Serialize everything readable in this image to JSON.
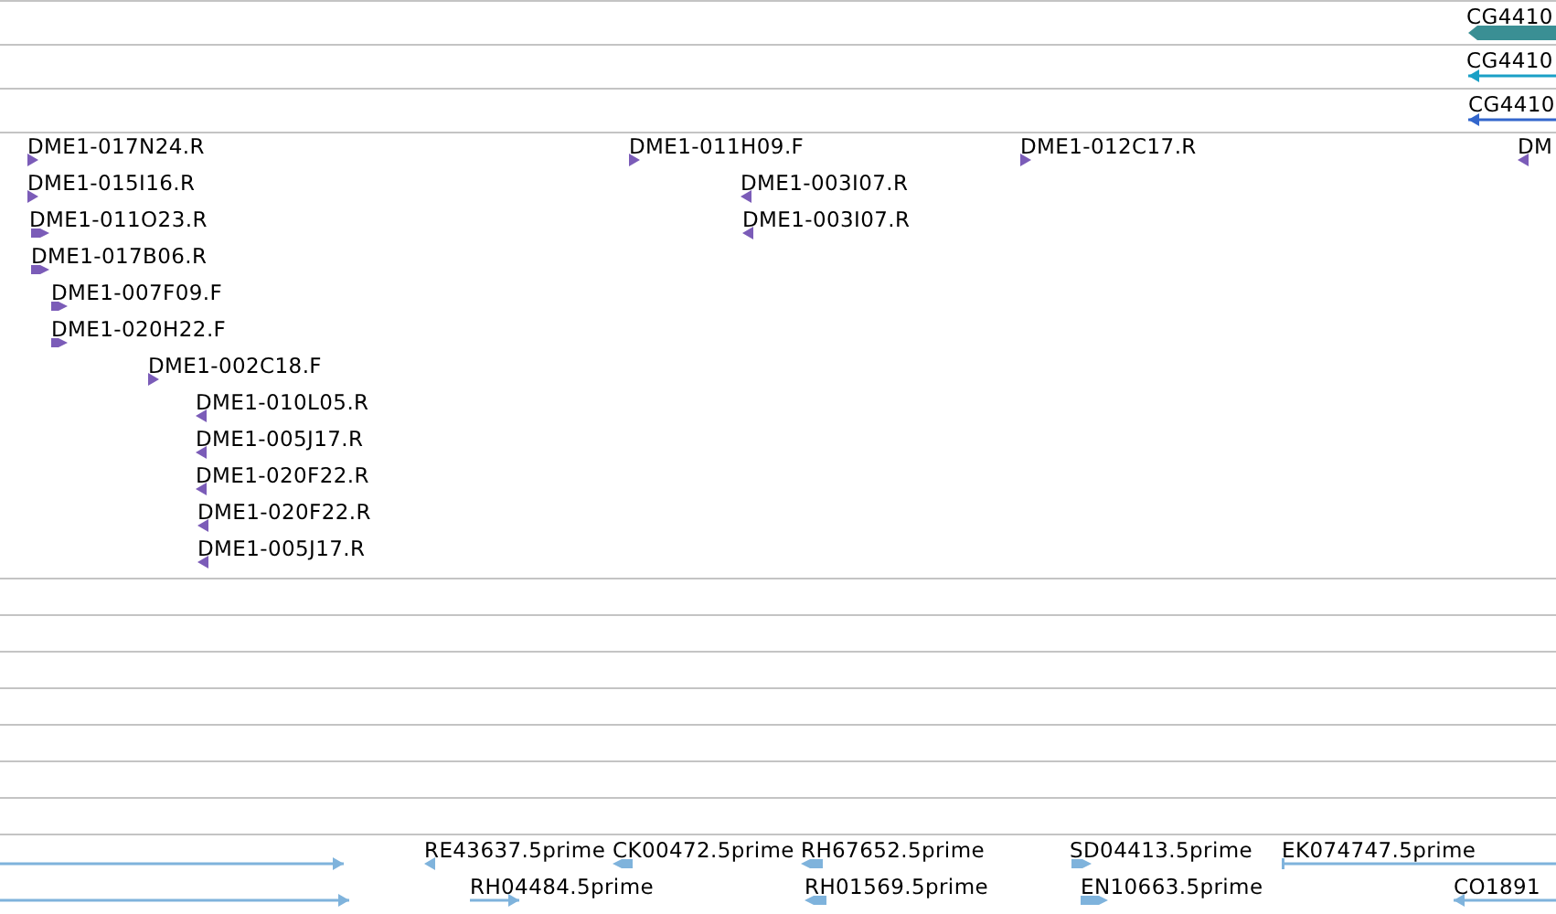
{
  "tracks": [
    {
      "color": "#3a8f94",
      "features": [
        {
          "label": "CG4410",
          "kind": "thick",
          "reverse": true
        }
      ]
    },
    {
      "color": "#1aa0c6",
      "features": [
        {
          "label": "CG4410",
          "kind": "line",
          "reverse": true
        }
      ]
    },
    {
      "color": "#3366cc",
      "features": [
        {
          "label": "CG4410",
          "kind": "line",
          "reverse": true
        }
      ]
    },
    {
      "color": "#7b5cb8",
      "features": [
        {
          "label": "DME1-017N24.R",
          "kind": "tri",
          "reverse": false
        },
        {
          "label": "DME1-015I16.R",
          "kind": "tri",
          "reverse": false
        },
        {
          "label": "DME1-011O23.R",
          "kind": "block",
          "reverse": false
        },
        {
          "label": "DME1-017B06.R",
          "kind": "block",
          "reverse": false
        },
        {
          "label": "DME1-007F09.F",
          "kind": "block",
          "reverse": false
        },
        {
          "label": "DME1-020H22.F",
          "kind": "block",
          "reverse": false
        },
        {
          "label": "DME1-002C18.F",
          "kind": "tri",
          "reverse": false
        },
        {
          "label": "DME1-010L05.R",
          "kind": "tri",
          "reverse": true
        },
        {
          "label": "DME1-005J17.R",
          "kind": "tri",
          "reverse": true
        },
        {
          "label": "DME1-020F22.R",
          "kind": "tri",
          "reverse": true
        },
        {
          "label": "DME1-020F22.R",
          "kind": "tri",
          "reverse": true
        },
        {
          "label": "DME1-005J17.R",
          "kind": "tri",
          "reverse": true
        },
        {
          "label": "DME1-011H09.F",
          "kind": "tri",
          "reverse": false
        },
        {
          "label": "DME1-003I07.R",
          "kind": "tri",
          "reverse": true
        },
        {
          "label": "DME1-003I07.R",
          "kind": "tri",
          "reverse": true
        },
        {
          "label": "DME1-012C17.R",
          "kind": "tri",
          "reverse": false
        },
        {
          "label": "DM",
          "kind": "tri",
          "reverse": true
        }
      ]
    },
    {
      "color": "#7fb3dc",
      "features": [
        {
          "kind": "line",
          "reverse": false
        },
        {
          "label": "RE43637.5prime",
          "kind": "tri",
          "reverse": true
        },
        {
          "label": "CK00472.5prime",
          "kind": "block",
          "reverse": true
        },
        {
          "label": "RH67652.5prime",
          "kind": "block",
          "reverse": true
        },
        {
          "label": "SD04413.5prime",
          "kind": "block",
          "reverse": false
        },
        {
          "label": "EK074747.5prime",
          "kind": "line"
        },
        {
          "kind": "line",
          "reverse": false
        },
        {
          "label": "RH04484.5prime",
          "kind": "line",
          "reverse": false
        },
        {
          "label": "RH01569.5prime",
          "kind": "block",
          "reverse": true
        },
        {
          "label": "EN10663.5prime",
          "kind": "block",
          "reverse": false
        },
        {
          "label": "CO1891",
          "kind": "line",
          "reverse": true
        }
      ]
    }
  ]
}
